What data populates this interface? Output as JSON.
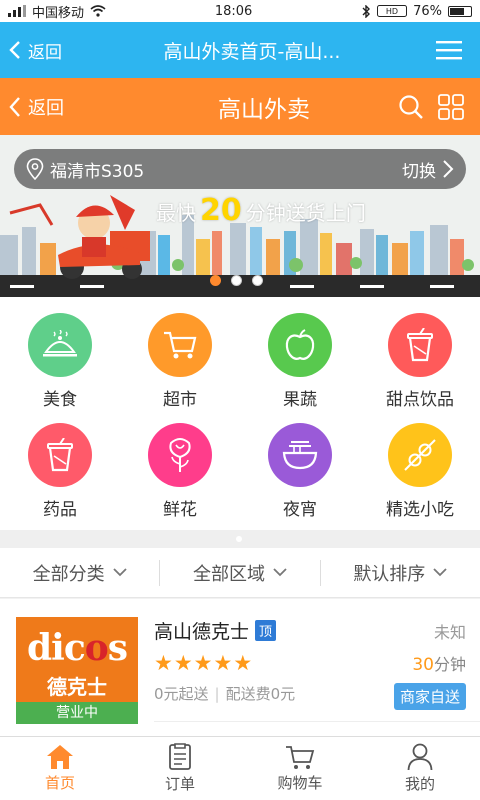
{
  "status": {
    "carrier": "中国移动",
    "time": "18:06",
    "battery": "76%",
    "battery_level": 0.76
  },
  "browser_header": {
    "back_label": "返回",
    "title": "高山外卖首页-高山..."
  },
  "app_header": {
    "back_label": "返回",
    "title": "高山外卖"
  },
  "banner": {
    "location": "福清市S305",
    "switch_label": "切换",
    "slogan_prefix": "最快",
    "slogan_number": "20",
    "slogan_suffix": "分钟送货上门",
    "slides": 3,
    "active_slide": 0
  },
  "categories": [
    {
      "label": "美食",
      "icon": "food-cover-icon",
      "color": "#5fcf8a"
    },
    {
      "label": "超市",
      "icon": "cart-icon",
      "color": "#ff9a2a"
    },
    {
      "label": "果蔬",
      "icon": "apple-icon",
      "color": "#58c94e"
    },
    {
      "label": "甜点饮品",
      "icon": "cup-icon",
      "color": "#ff5a5a"
    },
    {
      "label": "药品",
      "icon": "cup-icon",
      "color": "#ff5a6a"
    },
    {
      "label": "鲜花",
      "icon": "rose-icon",
      "color": "#ff3d8b"
    },
    {
      "label": "夜宵",
      "icon": "noodle-icon",
      "color": "#9a5ad8"
    },
    {
      "label": "精选小吃",
      "icon": "skewer-icon",
      "color": "#ffc31a"
    }
  ],
  "filters": [
    {
      "label": "全部分类"
    },
    {
      "label": "全部区域"
    },
    {
      "label": "默认排序"
    }
  ],
  "shop": {
    "name": "高山德克士",
    "top_tag": "顶",
    "logo_text": "dicos",
    "logo_cn": "德克士",
    "open_status": "营业中",
    "rating": 5,
    "distance": "未知",
    "delivery_time_value": "30",
    "delivery_time_unit": "分钟",
    "min_order": "0元起送",
    "delivery_fee": "配送费0元",
    "delivery_type": "商家自送"
  },
  "tabs": [
    {
      "label": "首页",
      "icon": "home-icon",
      "active": true
    },
    {
      "label": "订单",
      "icon": "order-icon",
      "active": false
    },
    {
      "label": "购物车",
      "icon": "cart-icon",
      "active": false
    },
    {
      "label": "我的",
      "icon": "user-icon",
      "active": false
    }
  ],
  "colors": {
    "browser_bar": "#2db5f0",
    "app_bar": "#ff8a2e",
    "accent": "#ff8a2e"
  }
}
